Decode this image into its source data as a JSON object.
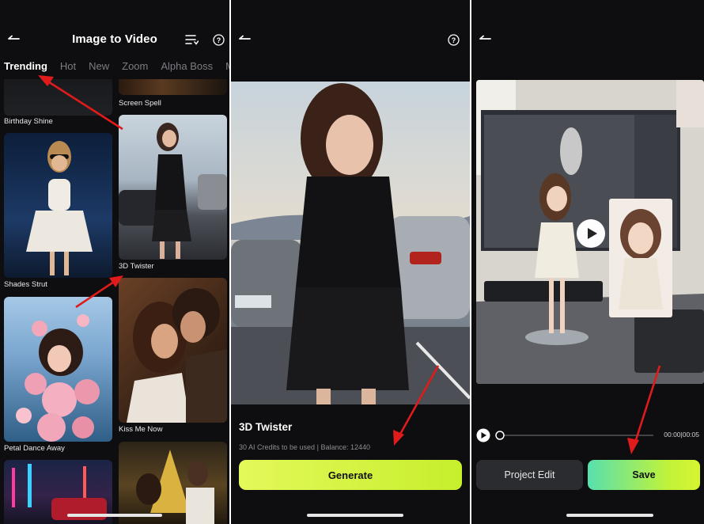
{
  "colors": {
    "background": "#0e0e10",
    "generate_button": "#d4f442",
    "save_gradient": [
      "#57e0ae",
      "#d7f52e"
    ],
    "annotation_arrow": "#e01b1b"
  },
  "panel1": {
    "title": "Image to Video",
    "tabs": [
      "Trending",
      "Hot",
      "New",
      "Zoom",
      "Alpha Boss",
      "M"
    ],
    "active_tab": "Trending",
    "templates": [
      "Birthday Shine",
      "Screen Spell",
      "Shades Strut",
      "3D Twister",
      "Petal Dance Away",
      "Kiss Me Now"
    ]
  },
  "panel2": {
    "template_name": "3D Twister",
    "credits_text": "30 AI Credits to be used",
    "separator": "|",
    "balance_text": "Balance: 12440",
    "generate_label": "Generate"
  },
  "panel3": {
    "time_display": "00:00|00:05",
    "project_edit_label": "Project Edit",
    "save_label": "Save"
  }
}
